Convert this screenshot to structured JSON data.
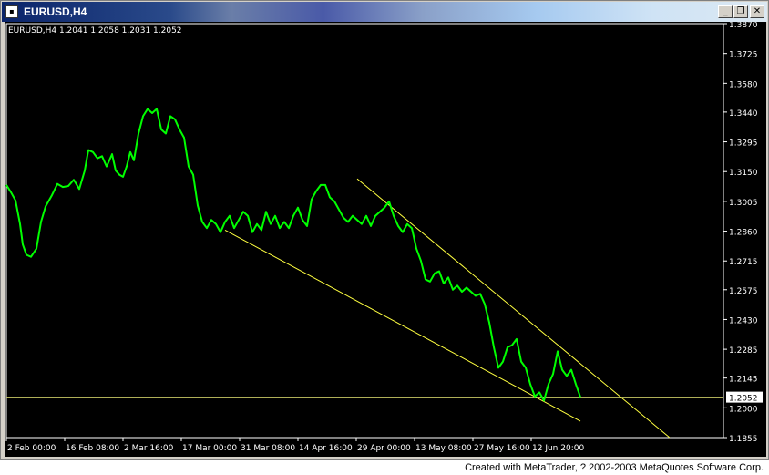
{
  "window": {
    "title": "EURUSD,H4",
    "icon": "chart-window-icon",
    "buttons": [
      {
        "name": "minimize-button",
        "icon": "minimize-icon",
        "glyph": "_"
      },
      {
        "name": "restore-button",
        "icon": "restore-icon",
        "glyph": "❐"
      },
      {
        "name": "close-button",
        "icon": "close-icon",
        "glyph": "✕"
      }
    ]
  },
  "footer": "Created with MetaTrader, ? 2002-2003 MetaQuotes Software Corp.",
  "colors": {
    "background": "#000000",
    "price_line": "#00ff00",
    "trendline": "#ffff40",
    "axis_text": "#ffffff",
    "current_price_line": "#c8c864"
  },
  "chart_data": {
    "type": "line",
    "info_label": "EURUSD,H4  1.2041 1.2058 1.2031 1.2052",
    "symbol": "EURUSD,H4",
    "ohlc": {
      "open": 1.2041,
      "high": 1.2058,
      "low": 1.2031,
      "close": 1.2052
    },
    "current_price": 1.2052,
    "current_price_label": "1.2052",
    "ylim": [
      1.1855,
      1.387
    ],
    "y_ticks": [
      "1.3870",
      "1.3725",
      "1.3580",
      "1.3440",
      "1.3295",
      "1.3150",
      "1.3005",
      "1.2860",
      "1.2715",
      "1.2575",
      "1.2430",
      "1.2285",
      "1.2145",
      "1.2000",
      "1.1855"
    ],
    "x_ticks": [
      "2 Feb 00:00",
      "16 Feb 08:00",
      "2 Mar 16:00",
      "17 Mar 00:00",
      "31 Mar 08:00",
      "14 Apr 16:00",
      "29 Apr 00:00",
      "13 May 08:00",
      "27 May 16:00",
      "12 Jun 20:00"
    ],
    "series": [
      {
        "x": [
          0,
          5,
          10,
          15,
          18,
          22,
          27,
          33,
          38,
          43,
          50,
          56,
          62,
          68,
          74,
          80,
          86,
          90,
          95,
          100,
          105,
          110,
          116,
          120,
          124,
          128,
          132,
          136,
          140,
          145,
          150,
          155,
          160,
          165,
          170,
          175,
          180,
          185,
          190,
          195,
          200,
          205,
          210,
          215,
          220,
          225,
          230,
          235,
          240,
          245,
          250,
          255,
          260,
          265,
          270,
          275,
          280,
          285,
          290,
          295,
          300,
          305,
          310,
          315,
          320,
          325,
          330,
          335,
          340,
          345,
          350,
          355,
          360,
          365,
          370,
          375,
          380,
          385,
          390,
          395,
          400,
          405,
          410,
          415,
          420,
          425,
          430,
          435,
          440,
          445,
          450,
          455,
          460,
          465,
          470,
          475,
          480,
          485,
          490,
          495,
          500,
          505,
          510,
          515,
          520,
          525,
          530,
          535,
          540,
          545,
          550,
          555,
          560,
          565,
          570,
          575,
          580,
          585,
          590,
          595,
          600,
          605,
          610,
          615,
          620,
          625,
          630
        ],
        "y": [
          1.3085,
          1.305,
          1.301,
          1.2895,
          1.2795,
          1.2745,
          1.2735,
          1.2775,
          1.2905,
          1.298,
          1.3035,
          1.309,
          1.3075,
          1.308,
          1.311,
          1.3065,
          1.3155,
          1.3255,
          1.3245,
          1.3215,
          1.3225,
          1.3175,
          1.3235,
          1.3155,
          1.3135,
          1.3125,
          1.3175,
          1.3245,
          1.3205,
          1.3335,
          1.342,
          1.3455,
          1.3435,
          1.3455,
          1.3355,
          1.3335,
          1.342,
          1.3405,
          1.3355,
          1.3315,
          1.3175,
          1.3135,
          1.2985,
          1.2905,
          1.2875,
          1.2915,
          1.2895,
          1.2855,
          1.2905,
          1.2935,
          1.2875,
          1.2915,
          1.2955,
          1.2935,
          1.2855,
          1.2895,
          1.2865,
          1.2955,
          1.2895,
          1.2935,
          1.2875,
          1.2905,
          1.2875,
          1.2935,
          1.2975,
          1.2915,
          1.2885,
          1.3015,
          1.3055,
          1.3085,
          1.3085,
          1.3025,
          1.3005,
          1.2965,
          1.2925,
          1.2905,
          1.2935,
          1.2915,
          1.2895,
          1.2935,
          1.2885,
          1.2935,
          1.2955,
          1.2975,
          1.3005,
          1.2935,
          1.2885,
          1.2855,
          1.2895,
          1.2875,
          1.2775,
          1.2715,
          1.2625,
          1.2615,
          1.2655,
          1.2665,
          1.2605,
          1.2635,
          1.2575,
          1.2595,
          1.2565,
          1.2585,
          1.2565,
          1.2545,
          1.2555,
          1.2505,
          1.2415,
          1.2295,
          1.2195,
          1.2225,
          1.2295,
          1.2305,
          1.2335,
          1.2225,
          1.2195,
          1.2115,
          1.2055,
          1.2075,
          1.2035,
          1.2115,
          1.2165,
          1.2275,
          1.2185,
          1.2155,
          1.2185,
          1.2115,
          1.2052
        ],
        "x_note_unit": "bar index"
      }
    ],
    "trendlines": [
      {
        "from": {
          "x": 240,
          "y": 1.2865
        },
        "to": {
          "x": 630,
          "y": 1.1935
        }
      },
      {
        "from": {
          "x": 385,
          "y": 1.3115
        },
        "to": {
          "x": 728,
          "y": 1.1855
        }
      }
    ],
    "grid": false,
    "legend": "none"
  }
}
